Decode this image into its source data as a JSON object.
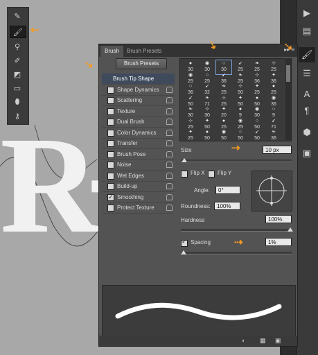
{
  "panel": {
    "tabs": [
      "Brush",
      "Brush Presets"
    ],
    "menu_glyph": "▸▸ ≡",
    "presets_button": "Brush Presets",
    "options": [
      {
        "label": "Brush Tip Shape",
        "checkbox": false,
        "checked": false,
        "lock": false,
        "selected": true
      },
      {
        "label": "Shape Dynamics",
        "checkbox": true,
        "checked": false,
        "lock": true
      },
      {
        "label": "Scattering",
        "checkbox": true,
        "checked": false,
        "lock": true
      },
      {
        "label": "Texture",
        "checkbox": true,
        "checked": false,
        "lock": true
      },
      {
        "label": "Dual Brush",
        "checkbox": true,
        "checked": false,
        "lock": true
      },
      {
        "label": "Color Dynamics",
        "checkbox": true,
        "checked": false,
        "lock": true
      },
      {
        "label": "Transfer",
        "checkbox": true,
        "checked": false,
        "lock": true
      },
      {
        "label": "Brush Pose",
        "checkbox": true,
        "checked": false,
        "lock": true
      },
      {
        "label": "Noise",
        "checkbox": true,
        "checked": false,
        "lock": true
      },
      {
        "label": "Wet Edges",
        "checkbox": true,
        "checked": false,
        "lock": true
      },
      {
        "label": "Build-up",
        "checkbox": true,
        "checked": false,
        "lock": true
      },
      {
        "label": "Smoothing",
        "checkbox": true,
        "checked": true,
        "lock": true
      },
      {
        "label": "Protect Texture",
        "checkbox": true,
        "checked": false,
        "lock": true
      }
    ],
    "tip_rows": [
      [
        "30",
        "30",
        "30",
        "25",
        "25",
        "25"
      ],
      [
        "25",
        "25",
        "36",
        "25",
        "36",
        "36"
      ],
      [
        "36",
        "32",
        "25",
        "50",
        "25",
        "25"
      ],
      [
        "50",
        "71",
        "25",
        "50",
        "50",
        "36"
      ],
      [
        "30",
        "30",
        "20",
        "9",
        "30",
        "9"
      ],
      [
        "25",
        "50",
        "25",
        "25",
        "50",
        "71"
      ],
      [
        "25",
        "50",
        "50",
        "50",
        "50",
        "36"
      ]
    ],
    "selected_tip": {
      "row": 0,
      "col": 2
    },
    "size_label": "Size",
    "size_value": "10 px",
    "flip_x": "Flip X",
    "flip_y": "Flip Y",
    "angle_label": "Angle:",
    "angle_value": "0°",
    "roundness_label": "Roundness:",
    "roundness_value": "100%",
    "hardness_label": "Hardness",
    "hardness_value": "100%",
    "spacing_label": "Spacing",
    "spacing_checked": true,
    "spacing_value": "1%",
    "size_slider": 0.02,
    "hardness_slider": 1.0,
    "spacing_slider": 0.01
  },
  "canvas": {
    "letter1": "R",
    "letter2": "-"
  },
  "colors": {
    "accent_arrow": "#f59a23",
    "panel_bg": "#535353",
    "selected_row": "#3f4a5c"
  }
}
